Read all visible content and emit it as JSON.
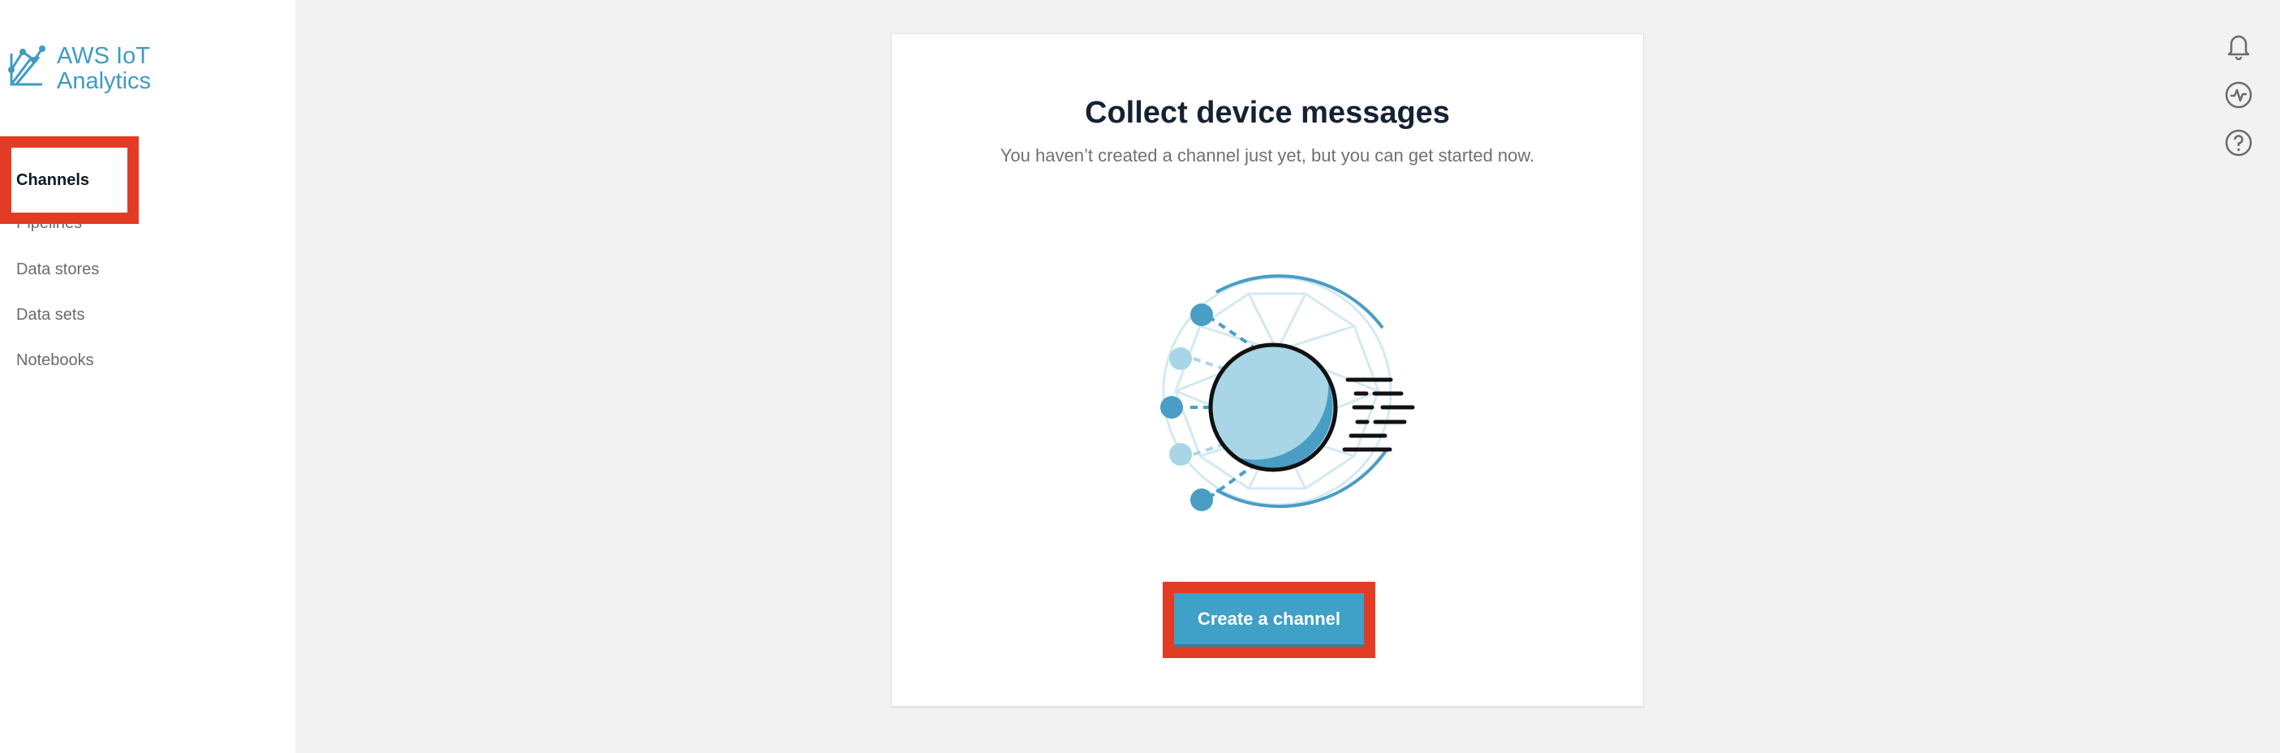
{
  "app": {
    "title_line1": "AWS IoT",
    "title_line2": "Analytics",
    "brand_color": "#3f9bc4"
  },
  "sidebar": {
    "items": [
      {
        "label": "Channels",
        "active": true
      },
      {
        "label": "Pipelines",
        "active": false
      },
      {
        "label": "Data stores",
        "active": false
      },
      {
        "label": "Data sets",
        "active": false
      },
      {
        "label": "Notebooks",
        "active": false
      }
    ]
  },
  "main": {
    "title": "Collect device messages",
    "subtitle": "You haven’t created a channel just yet, but you can get started now.",
    "cta_label": "Create a channel",
    "illustration": "channel-ingest-illustration"
  },
  "toolbar": {
    "icons": [
      "bell-icon",
      "activity-icon",
      "help-icon"
    ]
  },
  "colors": {
    "highlight": "#e33c24",
    "primary_button": "#3fa0c8",
    "accent_light": "#a8d6e6",
    "accent_dark": "#4a9dc4"
  }
}
